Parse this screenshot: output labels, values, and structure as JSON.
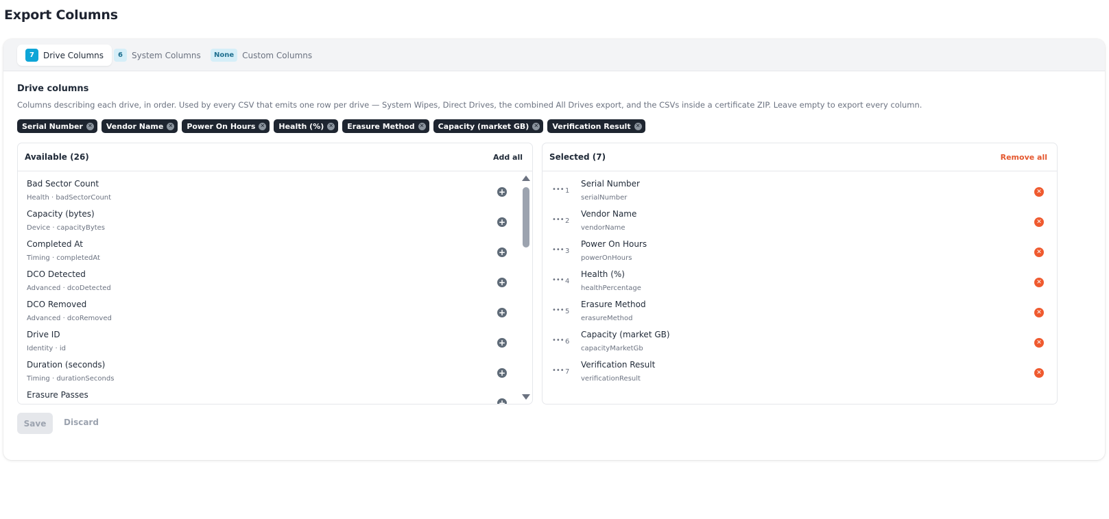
{
  "page": {
    "title": "Export Columns"
  },
  "tabs": [
    {
      "badge": "7",
      "label": "Drive Columns",
      "active": true
    },
    {
      "badge": "6",
      "label": "System Columns",
      "active": false
    },
    {
      "badge": "None",
      "label": "Custom Columns",
      "active": false
    }
  ],
  "section": {
    "title": "Drive columns",
    "description": "Columns describing each drive, in order. Used by every CSV that emits one row per drive — System Wipes, Direct Drives, the combined All Drives export, and the CSVs inside a certificate ZIP. Leave empty to export every column."
  },
  "chips": [
    "Serial Number",
    "Vendor Name",
    "Power On Hours",
    "Health (%)",
    "Erasure Method",
    "Capacity (market GB)",
    "Verification Result"
  ],
  "available": {
    "title": "Available (26)",
    "action": "Add all",
    "items": [
      {
        "name": "Bad Sector Count",
        "meta": "Health · badSectorCount"
      },
      {
        "name": "Capacity (bytes)",
        "meta": "Device · capacityBytes"
      },
      {
        "name": "Completed At",
        "meta": "Timing · completedAt"
      },
      {
        "name": "DCO Detected",
        "meta": "Advanced · dcoDetected"
      },
      {
        "name": "DCO Removed",
        "meta": "Advanced · dcoRemoved"
      },
      {
        "name": "Drive ID",
        "meta": "Identity · id"
      },
      {
        "name": "Duration (seconds)",
        "meta": "Timing · durationSeconds"
      },
      {
        "name": "Erasure Passes",
        "meta": ""
      }
    ]
  },
  "selected": {
    "title": "Selected (7)",
    "action": "Remove all",
    "items": [
      {
        "index": "1",
        "name": "Serial Number",
        "meta": "serialNumber"
      },
      {
        "index": "2",
        "name": "Vendor Name",
        "meta": "vendorName"
      },
      {
        "index": "3",
        "name": "Power On Hours",
        "meta": "powerOnHours"
      },
      {
        "index": "4",
        "name": "Health (%)",
        "meta": "healthPercentage"
      },
      {
        "index": "5",
        "name": "Erasure Method",
        "meta": "erasureMethod"
      },
      {
        "index": "6",
        "name": "Capacity (market GB)",
        "meta": "capacityMarketGb"
      },
      {
        "index": "7",
        "name": "Verification Result",
        "meta": "verificationResult"
      }
    ]
  },
  "footer": {
    "save_label": "Save",
    "discard_label": "Discard"
  },
  "icons": {
    "add": "plus-circle-icon",
    "remove": "x-circle-icon",
    "drag": "drag-handle-icon",
    "chip_remove": "x-icon"
  },
  "colors": {
    "accent": "#0ea5d7",
    "danger": "#ef5a2f",
    "chip_bg": "#1e2530"
  }
}
